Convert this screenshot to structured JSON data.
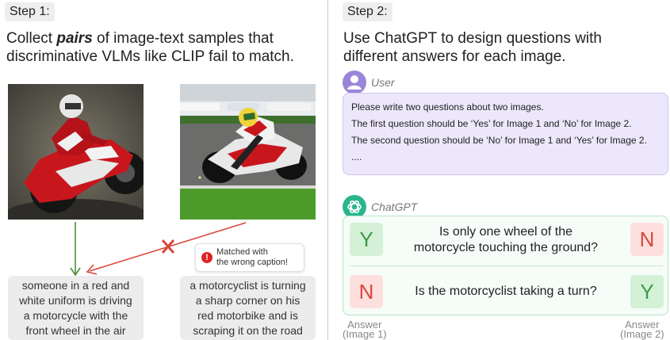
{
  "step1": {
    "label": "Step 1:",
    "heading_pre": "Collect ",
    "heading_bold": "pairs",
    "heading_post": " of image-text samples that",
    "heading_line2": "discriminative VLMs like CLIP fail to match."
  },
  "step2": {
    "label": "Step 2:",
    "heading_line1": "Use ChatGPT to design questions with",
    "heading_line2": "different answers for each image."
  },
  "captions": {
    "left": [
      "someone in a red and",
      "white uniform is driving",
      "a motorcycle with the",
      "front wheel in the air"
    ],
    "right": [
      "a motorcyclist is turning",
      "a sharp corner on his",
      "red motorbike and is",
      "scraping it on the road"
    ]
  },
  "callout": {
    "icon": "!",
    "line1": "Matched with",
    "line2": "the wrong caption!"
  },
  "user": {
    "role": "User",
    "lines": [
      "Please write two questions about two images.",
      "The first question should be ‘Yes’ for Image 1 and ‘No’ for Image 2.",
      "The second question should be ‘No’ for Image 1 and ‘Yes’ for Image 2.",
      "...."
    ]
  },
  "chatgpt": {
    "role": "ChatGPT",
    "q1": {
      "line1": "Is only one wheel of the",
      "line2": "motorcycle touching the ground?",
      "a1": "Y",
      "a2": "N"
    },
    "q2": {
      "text": "Is the motorcyclist taking a turn?",
      "a1": "N",
      "a2": "Y"
    }
  },
  "answer_labels": {
    "left": {
      "line1": "Answer",
      "line2": "(Image 1)"
    },
    "right": {
      "line1": "Answer",
      "line2": "(Image 2)"
    }
  },
  "colors": {
    "green_arrow": "#4a8f3a",
    "red_arrow": "#d9463a",
    "user_avatar": "#9b85d9",
    "gpt_avatar": "#2bb58c"
  }
}
